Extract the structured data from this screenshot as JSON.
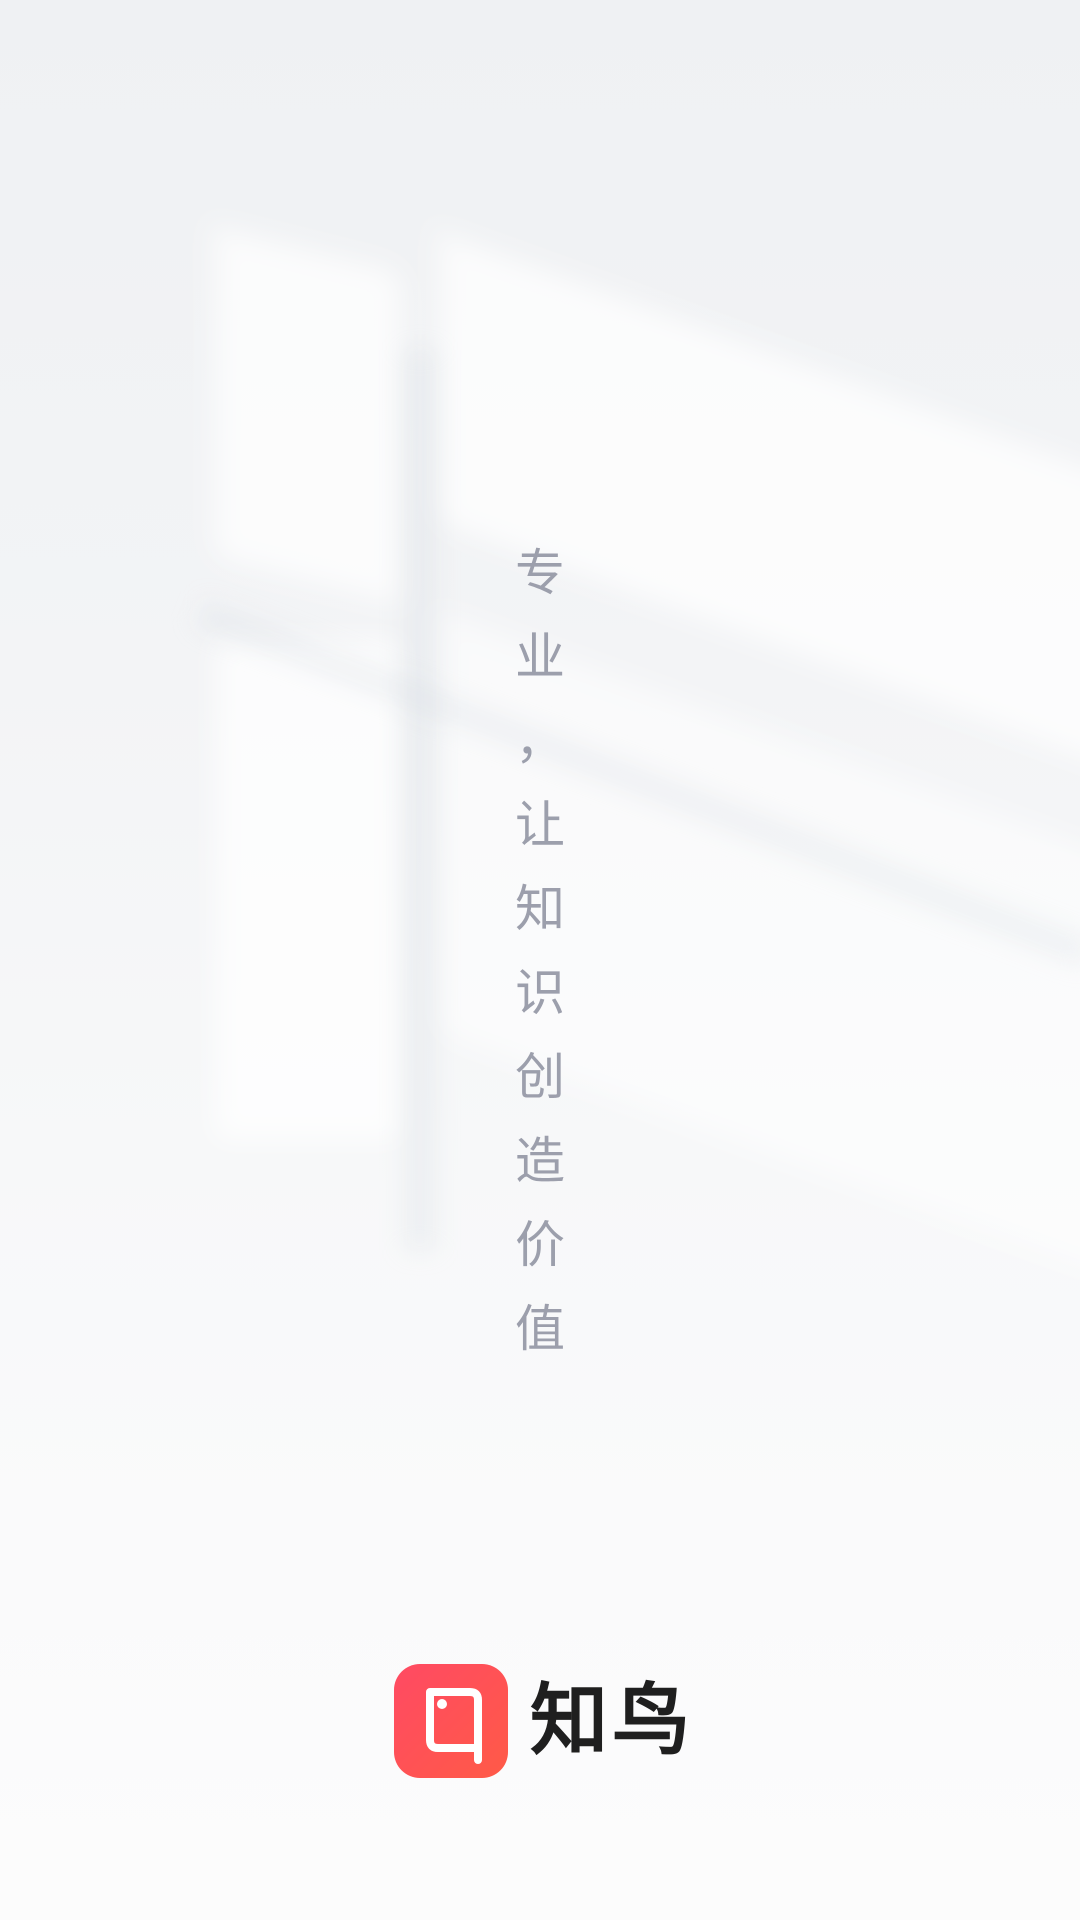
{
  "slogan": {
    "chars": [
      "专",
      "业",
      "，",
      "让",
      "知",
      "识",
      "创",
      "造",
      "价",
      "值"
    ]
  },
  "brand": {
    "name": "知鸟",
    "icon": "zhiniao-logo-icon",
    "accent_color": "#ff4d5a"
  }
}
